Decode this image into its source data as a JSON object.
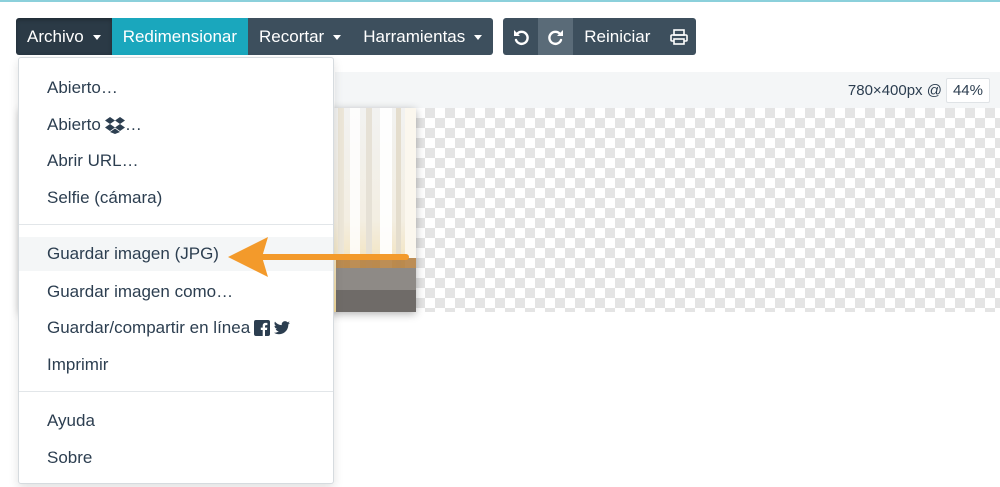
{
  "toolbar": {
    "archivo": "Archivo",
    "redimensionar": "Redimensionar",
    "recortar": "Recortar",
    "herramientas": "Harramientas",
    "reiniciar": "Reiniciar",
    "undo_icon": "undo-icon",
    "redo_icon": "redo-icon",
    "print_icon": "print-icon"
  },
  "status": {
    "dimensions": "780×400px @",
    "zoom": "44%"
  },
  "menu": {
    "open": "Abierto…",
    "open_dropbox": "Abierto",
    "open_dropbox_suffix": "…",
    "open_url": "Abrir URL…",
    "selfie": "Selfie (cámara)",
    "save_jpg": "Guardar imagen (JPG)",
    "save_as": "Guardar imagen como…",
    "share_online": "Guardar/compartir en línea",
    "print": "Imprimir",
    "help": "Ayuda",
    "about": "Sobre"
  },
  "colors": {
    "teal": "#1aa7bd",
    "dark": "#3d4f5d",
    "arrow": "#f39a2b"
  }
}
